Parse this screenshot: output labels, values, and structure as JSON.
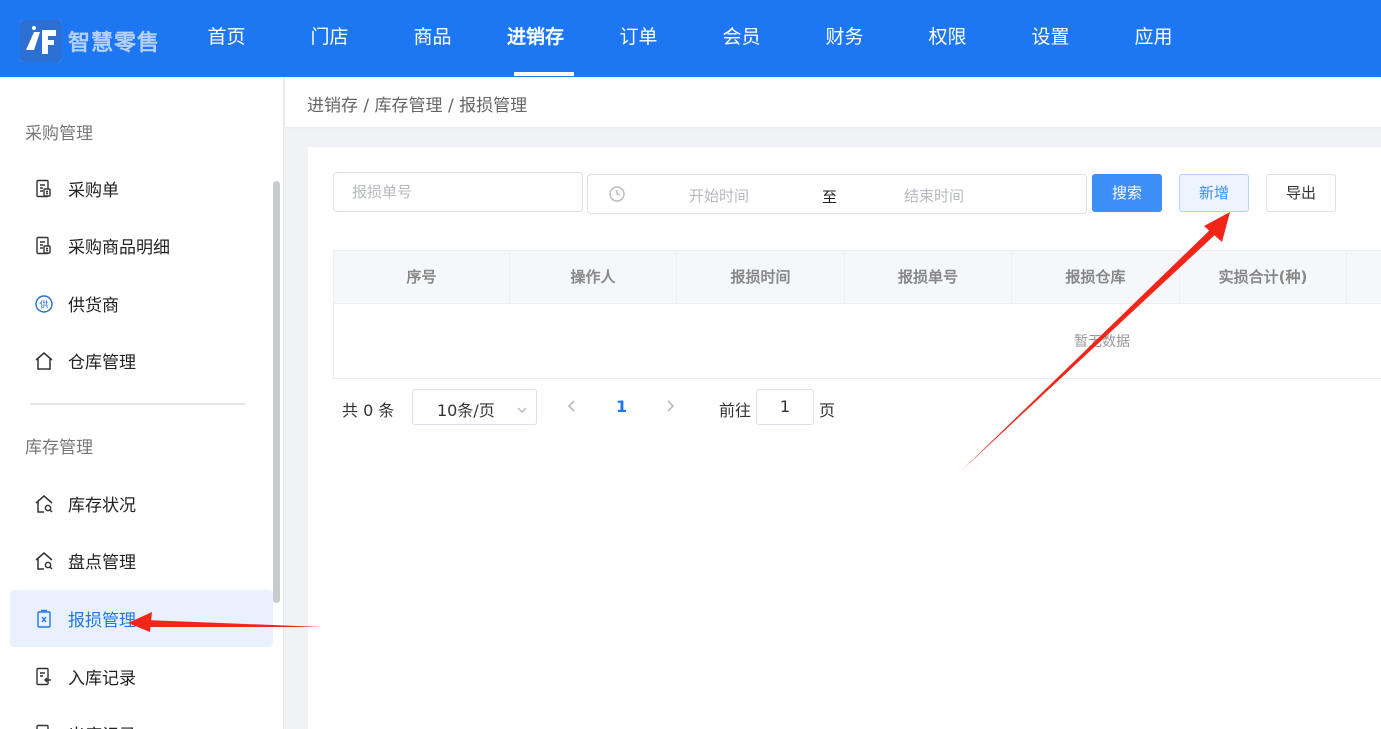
{
  "brand": {
    "name": "智慧零售",
    "accent": "#1e77f2"
  },
  "nav": {
    "items": [
      {
        "label": "首页"
      },
      {
        "label": "门店"
      },
      {
        "label": "商品"
      },
      {
        "label": "进销存"
      },
      {
        "label": "订单"
      },
      {
        "label": "会员"
      },
      {
        "label": "财务"
      },
      {
        "label": "权限"
      },
      {
        "label": "设置"
      },
      {
        "label": "应用"
      }
    ],
    "active": "进销存"
  },
  "sidebar": {
    "groups": [
      {
        "title": "采购管理",
        "items": [
          {
            "label": "采购单",
            "icon": "document-list-icon"
          },
          {
            "label": "采购商品明细",
            "icon": "document-list-icon"
          },
          {
            "label": "供货商",
            "icon": "supplier-badge-icon"
          },
          {
            "label": "仓库管理",
            "icon": "house-icon"
          }
        ]
      },
      {
        "title": "库存管理",
        "items": [
          {
            "label": "库存状况",
            "icon": "house-search-icon"
          },
          {
            "label": "盘点管理",
            "icon": "house-search-icon"
          },
          {
            "label": "报损管理",
            "icon": "trash-doc-icon",
            "active": true
          },
          {
            "label": "入库记录",
            "icon": "inbound-doc-icon"
          },
          {
            "label": "出库记录",
            "icon": "outbound-doc-icon"
          }
        ]
      }
    ]
  },
  "breadcrumb": {
    "text": "进销存 / 库存管理 / 报损管理"
  },
  "filters": {
    "order_placeholder": "报损单号",
    "start_placeholder": "开始时间",
    "range_separator": "至",
    "end_placeholder": "结束时间"
  },
  "buttons": {
    "search": "搜索",
    "add": "新增",
    "export": "导出"
  },
  "table": {
    "columns": [
      "序号",
      "操作人",
      "报损时间",
      "报损单号",
      "报损仓库",
      "实损合计(种)"
    ],
    "empty_text": "暂无数据"
  },
  "pagination": {
    "total_text": "共 0 条",
    "page_size": "10条/页",
    "current_page": "1",
    "goto_label": "前往",
    "goto_value": "1",
    "page_suffix": "页"
  },
  "annotation_color": "#f2251b"
}
